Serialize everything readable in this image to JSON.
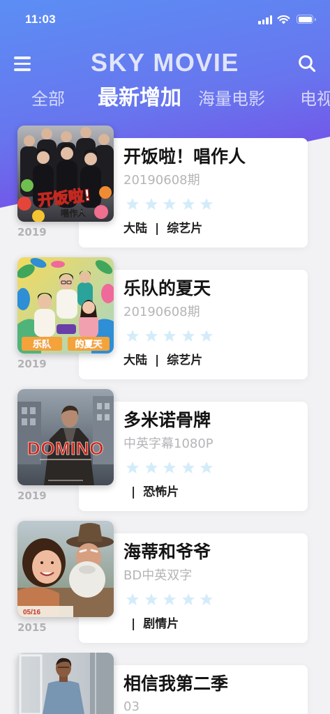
{
  "status_bar": {
    "time": "11:03",
    "icons": [
      "signal-icon",
      "wifi-icon",
      "battery-icon"
    ]
  },
  "header": {
    "title": "SKY MOVIE",
    "left_icon": "menu-icon",
    "right_icon": "search-icon"
  },
  "tabs": [
    {
      "label": "全部",
      "active": false
    },
    {
      "label": "最新增加",
      "active": true
    },
    {
      "label": "海量电影",
      "active": false
    },
    {
      "label": "电视",
      "active": false
    }
  ],
  "colors": {
    "header_gradient_start": "#5b8ef4",
    "header_gradient_end": "#7a3de4",
    "background": "#f2f2f4",
    "card": "#ffffff",
    "star": "#d4ecfa",
    "title_text": "#141414",
    "subtitle_text": "#b5b5b8",
    "year_text": "#b3b3b6"
  },
  "ui": {
    "tag_separator": "|"
  },
  "movies": [
    {
      "title": "开饭啦！唱作人",
      "subtitle": "20190608期",
      "year": "2019",
      "region": "大陆",
      "genre": "综艺片",
      "rating": 0,
      "max_rating": 5,
      "poster_text": [
        "开饭啦!",
        "唱作人"
      ]
    },
    {
      "title": "乐队的夏天",
      "subtitle": "20190608期",
      "year": "2019",
      "region": "大陆",
      "genre": "综艺片",
      "rating": 0,
      "max_rating": 5,
      "poster_text": [
        "乐队",
        "的夏天"
      ]
    },
    {
      "title": "多米诺骨牌",
      "subtitle": "中英字幕1080P",
      "year": "2019",
      "region": "",
      "genre": "恐怖片",
      "rating": 0,
      "max_rating": 5,
      "poster_text": [
        "DOMINO"
      ]
    },
    {
      "title": "海蒂和爷爷",
      "subtitle": "BD中英双字",
      "year": "2015",
      "region": "",
      "genre": "剧情片",
      "rating": 0,
      "max_rating": 5,
      "poster_text": [
        "05/16"
      ]
    },
    {
      "title": "相信我第二季",
      "subtitle": "03"
    }
  ]
}
